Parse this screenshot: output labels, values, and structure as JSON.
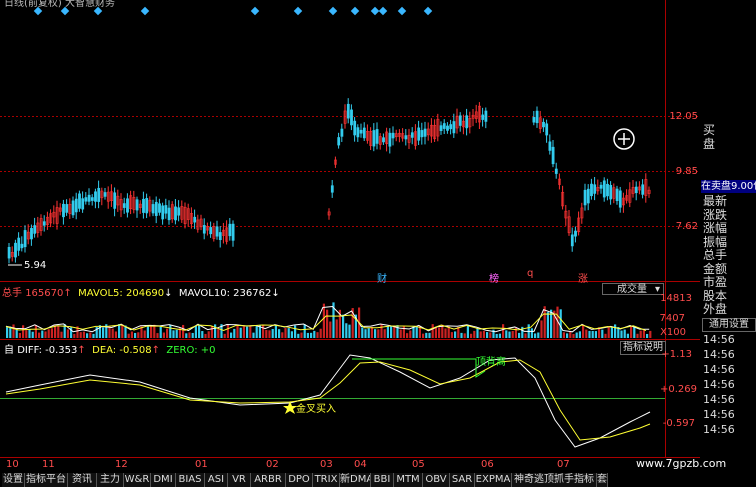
{
  "window": {
    "title": "日线(前复权) 大智慧财务"
  },
  "price_axis": {
    "labels": [
      "12.05",
      "9.85",
      "7.62"
    ]
  },
  "price_annotations": {
    "low_label": "5.94",
    "events": [
      "财",
      "榜",
      "q",
      "涨"
    ]
  },
  "side_panel": {
    "buy_label": "买",
    "buy_label2": "盘",
    "sell_row": "在卖盘9.00位",
    "fields": [
      "最新",
      "涨跌",
      "涨幅",
      "振幅",
      "总手",
      "金额",
      "市盈",
      "股本",
      "外盘"
    ],
    "settings_label": "通用设置"
  },
  "volume_panel": {
    "total_label": "总手",
    "total_value": "165670",
    "mavol5_label": "MAVOL5:",
    "mavol5_value": "204690",
    "mavol10_label": "MAVOL10:",
    "mavol10_value": "236762",
    "axis_labels": [
      "14813",
      "7407",
      "X100"
    ],
    "dropdown_label": "成交量"
  },
  "macd_panel": {
    "title": "自",
    "diff_label": "DIFF:",
    "diff_value": "-0.353",
    "dea_label": "DEA:",
    "dea_value": "-0.508",
    "zero_label": "ZERO:",
    "zero_value": "+0",
    "axis_labels": [
      "+1.13",
      "+0.269",
      "-0.597"
    ],
    "button_label": "指标说明",
    "annotation_buy": "金叉买入",
    "annotation_top": "顶背离"
  },
  "timestamps": [
    "14:56",
    "14:56",
    "14:56",
    "14:56",
    "14:56",
    "14:56",
    "14:56"
  ],
  "x_axis": {
    "labels": [
      "10",
      "11",
      "12",
      "01",
      "02",
      "03",
      "04",
      "05",
      "06",
      "07"
    ]
  },
  "watermark": "www.7gpzb.com",
  "bottom_tabs": [
    "设置",
    "指标平台",
    "资讯",
    "主力",
    "W&R",
    "DMI",
    "BIAS",
    "ASI",
    "VR",
    "ARBR",
    "DPO",
    "TRIX",
    "新DMA",
    "BBI",
    "MTM",
    "OBV",
    "SAR",
    "EXPMA",
    "神奇逃顶抓手指标",
    "套"
  ],
  "colors": {
    "up": "#ff3333",
    "down": "#33ccee",
    "grid": "#aa0000",
    "diff_line": "#ffffff",
    "dea_line": "#ffff33",
    "zero_line": "#33aa33"
  }
}
